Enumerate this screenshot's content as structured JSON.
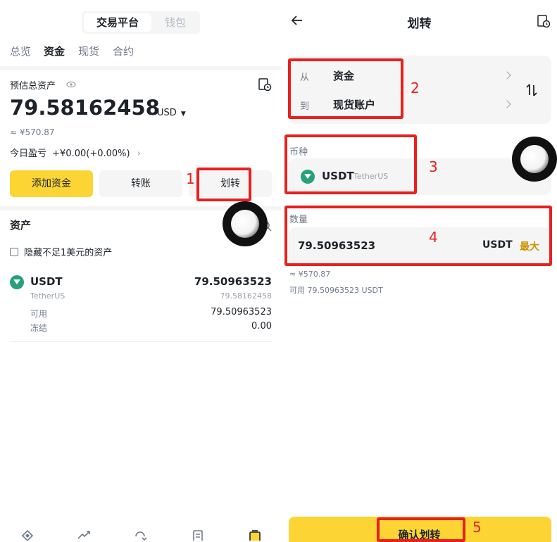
{
  "left": {
    "segment": {
      "active": "交易平台",
      "inactive": "钱包"
    },
    "tabs": [
      "总览",
      "资金",
      "现货",
      "合约"
    ],
    "active_tab": "资金",
    "total_label": "预估总资产",
    "balance": "79.58162458",
    "currency": "USD",
    "fiat_approx": "≈ ¥570.87",
    "pnl_label": "今日盈亏",
    "pnl_value": "+¥0.00(+0.00%)",
    "buttons": {
      "add": "添加资金",
      "transfer_out": "转账",
      "transfer": "划转"
    },
    "assets_title": "资产",
    "hide_small": "隐藏不足1美元的资产",
    "asset": {
      "symbol": "USDT",
      "name": "TetherUS",
      "amount": "79.50963523",
      "sub_amount": "79.58162458",
      "available_label": "可用",
      "available": "79.50963523",
      "frozen_label": "冻结",
      "frozen": "0.00"
    },
    "annotation": "1"
  },
  "right": {
    "title": "划转",
    "from_label": "从",
    "from_value": "资金",
    "to_label": "到",
    "to_value": "现货账户",
    "coin_label": "币种",
    "coin_symbol": "USDT",
    "coin_name": "TetherUS",
    "amount_label": "数量",
    "amount_value": "79.50963523",
    "amount_unit": "USDT",
    "max_label": "最大",
    "approx": "≈ ¥570.87",
    "available_text": "可用 79.50963523 USDT",
    "confirm": "确认划转",
    "annotations": {
      "a2": "2",
      "a3": "3",
      "a4": "4",
      "a5": "5"
    }
  },
  "colors": {
    "accent": "#fcd535",
    "annotation_red": "#e8201e",
    "max_gold": "#c99400",
    "usdt_green": "#26a17b"
  }
}
